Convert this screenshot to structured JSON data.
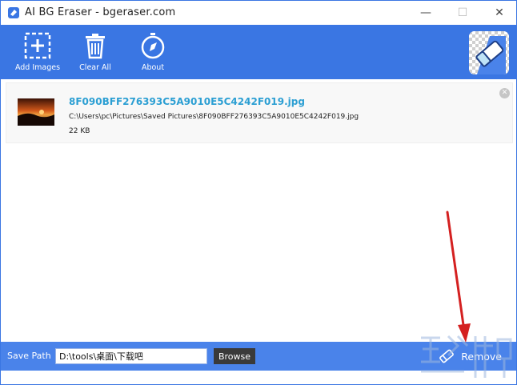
{
  "window": {
    "title": "AI BG Eraser - bgeraser.com",
    "controls": {
      "minimize": "—",
      "maximize": "☐",
      "close": "✕"
    }
  },
  "toolbar": {
    "add_images_label": "Add Images",
    "clear_all_label": "Clear All",
    "about_label": "About"
  },
  "files": [
    {
      "name": "8F090BFF276393C5A9010E5C4242F019.jpg",
      "path": "C:\\Users\\pc\\Pictures\\Saved Pictures\\8F090BFF276393C5A9010E5C4242F019.jpg",
      "size": "22 KB"
    }
  ],
  "bottom": {
    "save_path_label": "Save Path",
    "save_path_value": "D:\\tools\\桌面\\下载吧",
    "browse_label": "Browse",
    "remove_label": "Remove"
  },
  "colors": {
    "accent": "#3a76e3",
    "bottom_bar": "#4a83ea",
    "file_name": "#2c9fd3",
    "arrow": "#d42020"
  }
}
